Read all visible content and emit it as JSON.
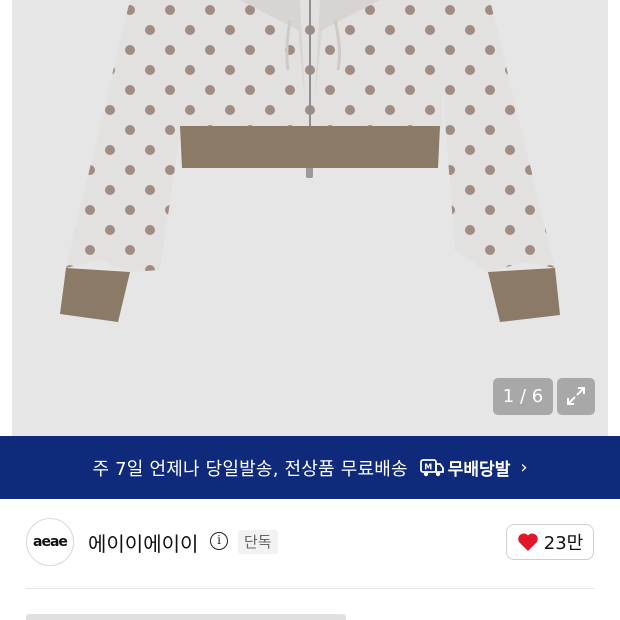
{
  "gallery": {
    "counter": "1 / 6",
    "colors": {
      "background": "#e6e6e6",
      "body": "#e3e1e0",
      "dot": "#a08c82",
      "rib": "#8a7a66"
    }
  },
  "banner": {
    "text": "주 7일 언제나 당일발송, 전상품 무료배송",
    "badge_label": "무배당발",
    "color": "#0f2a7a"
  },
  "brand": {
    "logo_text": "aeae",
    "name": "에이이에이이",
    "tag": "단독",
    "likes": "23만"
  }
}
